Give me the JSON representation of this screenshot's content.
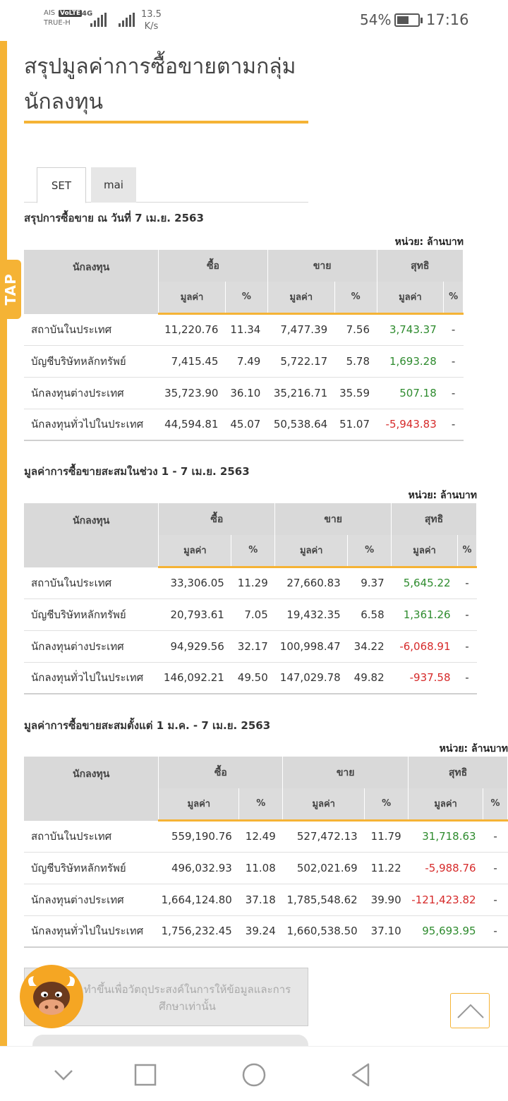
{
  "status_bar": {
    "carrier_top": "AIS",
    "carrier_bottom": "TRUE-H",
    "volte": "VoLTE",
    "network": "4G",
    "speed_value": "13.5",
    "speed_unit": "K/s",
    "battery_pct": "54%",
    "battery_level": 0.54,
    "time": "17:16"
  },
  "side_tab_label": "TAP",
  "page_title": "สรุปมูลค่าการซื้อขายตามกลุ่มนักลงทุน",
  "tabs": [
    {
      "label": "SET",
      "active": true
    },
    {
      "label": "mai",
      "active": false
    }
  ],
  "table_headers": {
    "investor": "นักลงทุน",
    "buy": "ซื้อ",
    "sell": "ขาย",
    "net": "สุทธิ",
    "value": "มูลค่า",
    "pct": "%"
  },
  "sections": [
    {
      "title": "สรุปการซื้อขาย ณ วันที่ 7 เม.ย. 2563",
      "unit": "หน่วย: ล้านบาท",
      "rows": [
        {
          "investor": "สถาบันในประเทศ",
          "buy_value": "11,220.76",
          "buy_pct": "11.34",
          "sell_value": "7,477.39",
          "sell_pct": "7.56",
          "net_value": "3,743.37",
          "net_pct": "-"
        },
        {
          "investor": "บัญชีบริษัทหลักทรัพย์",
          "buy_value": "7,415.45",
          "buy_pct": "7.49",
          "sell_value": "5,722.17",
          "sell_pct": "5.78",
          "net_value": "1,693.28",
          "net_pct": "-"
        },
        {
          "investor": "นักลงทุนต่างประเทศ",
          "buy_value": "35,723.90",
          "buy_pct": "36.10",
          "sell_value": "35,216.71",
          "sell_pct": "35.59",
          "net_value": "507.18",
          "net_pct": "-"
        },
        {
          "investor": "นักลงทุนทั่วไปในประเทศ",
          "buy_value": "44,594.81",
          "buy_pct": "45.07",
          "sell_value": "50,538.64",
          "sell_pct": "51.07",
          "net_value": "-5,943.83",
          "net_pct": "-"
        }
      ]
    },
    {
      "title": "มูลค่าการซื้อขายสะสมในช่วง 1 - 7 เม.ย. 2563",
      "unit": "หน่วย: ล้านบาท",
      "rows": [
        {
          "investor": "สถาบันในประเทศ",
          "buy_value": "33,306.05",
          "buy_pct": "11.29",
          "sell_value": "27,660.83",
          "sell_pct": "9.37",
          "net_value": "5,645.22",
          "net_pct": "-"
        },
        {
          "investor": "บัญชีบริษัทหลักทรัพย์",
          "buy_value": "20,793.61",
          "buy_pct": "7.05",
          "sell_value": "19,432.35",
          "sell_pct": "6.58",
          "net_value": "1,361.26",
          "net_pct": "-"
        },
        {
          "investor": "นักลงทุนต่างประเทศ",
          "buy_value": "94,929.56",
          "buy_pct": "32.17",
          "sell_value": "100,998.47",
          "sell_pct": "34.22",
          "net_value": "-6,068.91",
          "net_pct": "-"
        },
        {
          "investor": "นักลงทุนทั่วไปในประเทศ",
          "buy_value": "146,092.21",
          "buy_pct": "49.50",
          "sell_value": "147,029.78",
          "sell_pct": "49.82",
          "net_value": "-937.58",
          "net_pct": "-"
        }
      ]
    },
    {
      "title": "มูลค่าการซื้อขายสะสมตั้งแต่ 1 ม.ค. - 7 เม.ย. 2563",
      "unit": "หน่วย: ล้านบาท",
      "rows": [
        {
          "investor": "สถาบันในประเทศ",
          "buy_value": "559,190.76",
          "buy_pct": "12.49",
          "sell_value": "527,472.13",
          "sell_pct": "11.79",
          "net_value": "31,718.63",
          "net_pct": "-"
        },
        {
          "investor": "บัญชีบริษัทหลักทรัพย์",
          "buy_value": "496,032.93",
          "buy_pct": "11.08",
          "sell_value": "502,021.69",
          "sell_pct": "11.22",
          "net_value": "-5,988.76",
          "net_pct": "-"
        },
        {
          "investor": "นักลงทุนต่างประเทศ",
          "buy_value": "1,664,124.80",
          "buy_pct": "37.18",
          "sell_value": "1,785,548.62",
          "sell_pct": "39.90",
          "net_value": "-121,423.82",
          "net_pct": "-"
        },
        {
          "investor": "นักลงทุนทั่วไปในประเทศ",
          "buy_value": "1,756,232.45",
          "buy_pct": "39.24",
          "sell_value": "1,660,538.50",
          "sell_pct": "37.10",
          "net_value": "95,693.95",
          "net_pct": "-"
        }
      ]
    }
  ],
  "disclaimer": "ทำขึ้นเพื่อวัตถุประสงค์ในการให้ข้อมูลและการศึกษาเท่านั้น",
  "colors": {
    "accent": "#f5b335",
    "positive": "#2e8b2e",
    "negative": "#d62a2a",
    "header_bg": "#d9d9d9"
  },
  "icons": {
    "scroll_top": "chevron-up-icon",
    "nav_back": "triangle-back-icon",
    "nav_home": "circle-home-icon",
    "nav_recent": "square-recent-icon",
    "nav_hide": "chevron-down-icon",
    "mascot": "bull-mascot-icon"
  }
}
